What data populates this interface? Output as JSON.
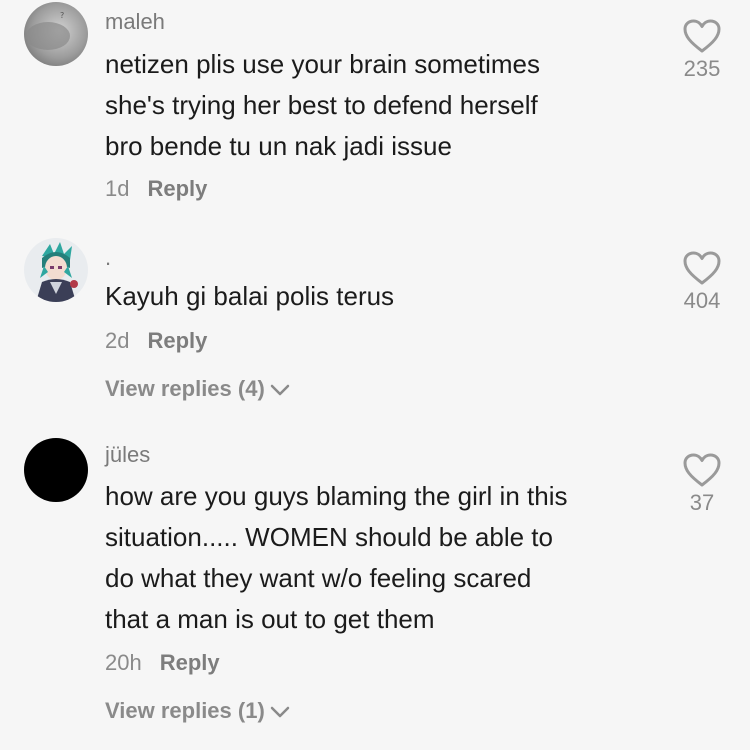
{
  "comments": [
    {
      "username": "maleh",
      "lines": [
        "netizen plis use your brain sometimes",
        "she's trying her best to defend herself",
        "bro bende tu un nak jadi issue"
      ],
      "time": "1d",
      "reply_label": "Reply",
      "likes": "235",
      "avatar_icon": "photo-avatar",
      "avatar_mark": "?"
    },
    {
      "username": ".",
      "lines": [
        "Kayuh gi balai polis terus"
      ],
      "time": "2d",
      "reply_label": "Reply",
      "likes": "404",
      "view_replies": "View replies (4)",
      "avatar_icon": "anime-character-avatar"
    },
    {
      "username": "jüles",
      "lines": [
        "how are you guys blaming the girl in this",
        "situation..... WOMEN should be able to",
        "do what they want w/o feeling scared",
        "that a man is out to get them"
      ],
      "time": "20h",
      "reply_label": "Reply",
      "likes": "37",
      "view_replies": "View replies (1)",
      "avatar_icon": "black-avatar"
    }
  ],
  "colors": {
    "background": "#f6f6f6",
    "username": "#7a7a7a",
    "text": "#1b1b1b",
    "meta": "#8a8a8a",
    "heart": "#9a9a9a"
  },
  "icons": {
    "like": "heart-outline-icon",
    "expand": "chevron-down-icon"
  }
}
